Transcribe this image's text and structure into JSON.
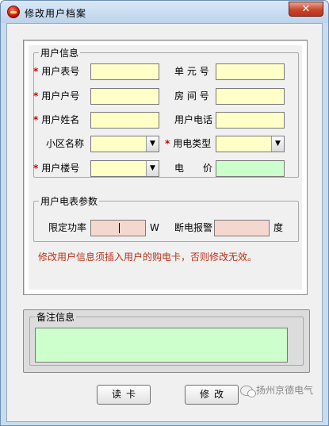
{
  "window": {
    "title": "修改用户档案",
    "close_glyph": "✕"
  },
  "user_group": {
    "legend": "用户信息",
    "required_mark": "*",
    "meter_no_label": "用户表号",
    "account_no_label": "用户户号",
    "name_label": "用户姓名",
    "district_label": "小区名称",
    "building_label": "用户楼号",
    "unit_label": "单 元 号",
    "room_label": "房 间 号",
    "phone_label": "用户电话",
    "power_type_label": "用电类型",
    "price_label": "电　　价"
  },
  "meter_group": {
    "legend": "用户电表参数",
    "power_limit_label": "限定功率",
    "power_limit_unit": "W",
    "alarm_label": "断电报警",
    "alarm_unit": "度"
  },
  "warning_text": "修改用户信息须插入用户的购电卡，否则修改无效。",
  "remark_group": {
    "legend": "备注信息"
  },
  "buttons": {
    "read_card": "读卡",
    "modify": "修改"
  },
  "watermark": "扬州京德电气",
  "colors": {
    "input_yellow": "#ffffc8",
    "input_green": "#ccffcc",
    "input_pink": "#f4d8d0",
    "warning_red": "#b8321a",
    "required_red": "#d00000"
  },
  "icons": {
    "dropdown": "▼"
  }
}
